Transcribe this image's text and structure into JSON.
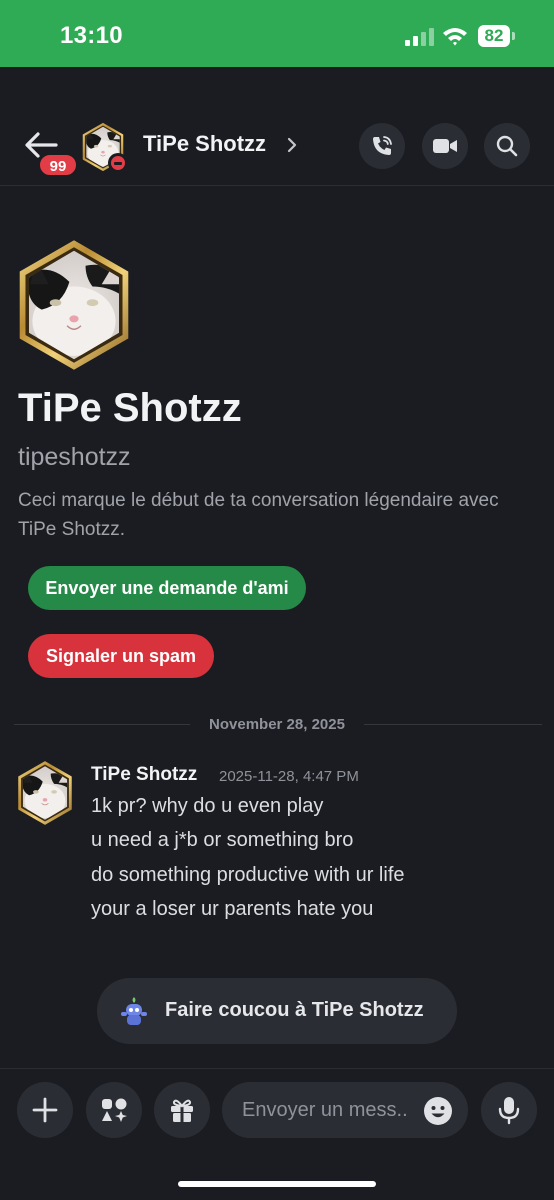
{
  "status_bar": {
    "time": "13:10",
    "battery": "82"
  },
  "header": {
    "back_badge": "99",
    "contact_name": "TiPe Shotzz"
  },
  "intro": {
    "display_name": "TiPe Shotzz",
    "username": "tipeshotzz",
    "description": "Ceci marque le début de ta conversation légendaire avec TiPe Shotzz.",
    "friend_request_button": "Envoyer une demande d'ami",
    "report_spam_button": "Signaler un spam"
  },
  "date_divider": "November 28, 2025",
  "message": {
    "author": "TiPe Shotzz",
    "timestamp": "2025-11-28, 4:47 PM",
    "lines": [
      "1k pr? why do u even play",
      "u need a j*b or something bro",
      "do something productive with ur life",
      "your a loser ur parents hate you"
    ]
  },
  "wave_button": {
    "label": "Faire coucou à TiPe Shotzz"
  },
  "composer": {
    "placeholder": "Envoyer un mess.."
  },
  "colors": {
    "status_bar": "#2faa55",
    "background": "#1b1c21",
    "surface": "#2b2d35",
    "friend_green": "#258a47",
    "spam_red": "#d8333c",
    "badge_red": "#e23c46",
    "gold_frame": "#c9a14a"
  },
  "icons": [
    "back-arrow-icon",
    "dnd-status-icon",
    "chevron-right-icon",
    "phone-call-icon",
    "video-camera-icon",
    "search-icon",
    "wumpus-wave-icon",
    "plus-icon",
    "apps-icon",
    "gift-icon",
    "emoji-icon",
    "microphone-icon",
    "wifi-icon",
    "signal-icon",
    "battery-icon"
  ]
}
